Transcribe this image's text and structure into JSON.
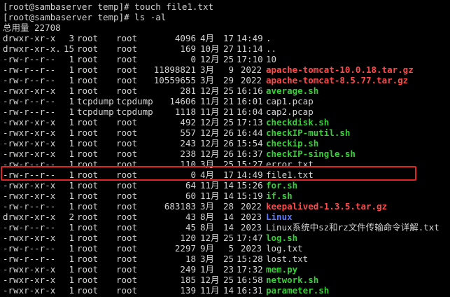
{
  "colors": {
    "default_text": "#d4d4d4",
    "directory": "#5c78ff",
    "executable": "#36d036",
    "archive": "#ff4a4a",
    "highlight_box": "#e02424"
  },
  "commands": [
    "[root@sambaserver temp]# touch file1.txt",
    "[root@sambaserver temp]# ls -al"
  ],
  "total_line": "总用量 22708",
  "listing": [
    {
      "perm": "drwxr-xr-x",
      "links": "3",
      "owner": "root",
      "group": "root",
      "size": "4096",
      "month": "4月",
      "day": "17",
      "time": "14:49",
      "name": ".",
      "kind": "default"
    },
    {
      "perm": "drwxr-xr-x.",
      "links": "15",
      "owner": "root",
      "group": "root",
      "size": "169",
      "month": "10月",
      "day": "27",
      "time": "11:14",
      "name": "..",
      "kind": "default"
    },
    {
      "perm": "-rw-r--r--",
      "links": "1",
      "owner": "root",
      "group": "root",
      "size": "0",
      "month": "12月",
      "day": "25",
      "time": "17:10",
      "name": "10",
      "kind": "default"
    },
    {
      "perm": "-rw-r--r--",
      "links": "1",
      "owner": "root",
      "group": "root",
      "size": "11898821",
      "month": "3月",
      "day": "9",
      "time": "2022",
      "name": "apache-tomcat-10.0.18.tar.gz",
      "kind": "archive"
    },
    {
      "perm": "-rw-r--r--",
      "links": "1",
      "owner": "root",
      "group": "root",
      "size": "10559655",
      "month": "3月",
      "day": "29",
      "time": "2022",
      "name": "apache-tomcat-8.5.77.tar.gz",
      "kind": "archive"
    },
    {
      "perm": "-rwxr-xr-x",
      "links": "1",
      "owner": "root",
      "group": "root",
      "size": "281",
      "month": "12月",
      "day": "25",
      "time": "16:16",
      "name": "average.sh",
      "kind": "executable"
    },
    {
      "perm": "-rw-r--r--",
      "links": "1",
      "owner": "tcpdump",
      "group": "tcpdump",
      "size": "14606",
      "month": "11月",
      "day": "21",
      "time": "16:01",
      "name": "cap1.pcap",
      "kind": "default"
    },
    {
      "perm": "-rw-r--r--",
      "links": "1",
      "owner": "tcpdump",
      "group": "tcpdump",
      "size": "1118",
      "month": "11月",
      "day": "21",
      "time": "16:04",
      "name": "cap2.pcap",
      "kind": "default"
    },
    {
      "perm": "-rwxr-xr-x",
      "links": "1",
      "owner": "root",
      "group": "root",
      "size": "492",
      "month": "12月",
      "day": "25",
      "time": "17:13",
      "name": "checkdisk.sh",
      "kind": "executable"
    },
    {
      "perm": "-rwxr-xr-x",
      "links": "1",
      "owner": "root",
      "group": "root",
      "size": "557",
      "month": "12月",
      "day": "26",
      "time": "16:44",
      "name": "checkIP-mutil.sh",
      "kind": "executable"
    },
    {
      "perm": "-rwxr-xr-x",
      "links": "1",
      "owner": "root",
      "group": "root",
      "size": "243",
      "month": "12月",
      "day": "26",
      "time": "15:54",
      "name": "checkip.sh",
      "kind": "executable"
    },
    {
      "perm": "-rwxr-xr-x",
      "links": "1",
      "owner": "root",
      "group": "root",
      "size": "238",
      "month": "12月",
      "day": "26",
      "time": "16:37",
      "name": "checkIP-single.sh",
      "kind": "executable"
    },
    {
      "perm": "-rw-r--r--",
      "links": "1",
      "owner": "root",
      "group": "root",
      "size": "110",
      "month": "3月",
      "day": "25",
      "time": "15:27",
      "name": "error.txt",
      "kind": "default"
    },
    {
      "perm": "-rw-r--r--",
      "links": "1",
      "owner": "root",
      "group": "root",
      "size": "0",
      "month": "4月",
      "day": "17",
      "time": "14:49",
      "name": "file1.txt",
      "kind": "default"
    },
    {
      "perm": "-rwxr-xr-x",
      "links": "1",
      "owner": "root",
      "group": "root",
      "size": "64",
      "month": "11月",
      "day": "14",
      "time": "15:26",
      "name": "for.sh",
      "kind": "executable"
    },
    {
      "perm": "-rwxr-xr-x",
      "links": "1",
      "owner": "root",
      "group": "root",
      "size": "60",
      "month": "11月",
      "day": "14",
      "time": "15:19",
      "name": "if.sh",
      "kind": "executable"
    },
    {
      "perm": "-rw-r--r--",
      "links": "1",
      "owner": "root",
      "group": "root",
      "size": "683183",
      "month": "3月",
      "day": "28",
      "time": "2022",
      "name": "keepalived-1.3.5.tar.gz",
      "kind": "archive"
    },
    {
      "perm": "drwxr-xr-x",
      "links": "2",
      "owner": "root",
      "group": "root",
      "size": "43",
      "month": "8月",
      "day": "14",
      "time": "2023",
      "name": "Linux",
      "kind": "directory"
    },
    {
      "perm": "-rw-r--r--",
      "links": "1",
      "owner": "root",
      "group": "root",
      "size": "45",
      "month": "8月",
      "day": "14",
      "time": "2023",
      "name": "Linux系统中sz和rz文件传输命令详解.txt",
      "kind": "default"
    },
    {
      "perm": "-rwxr-xr-x",
      "links": "1",
      "owner": "root",
      "group": "root",
      "size": "120",
      "month": "12月",
      "day": "25",
      "time": "17:47",
      "name": "log.sh",
      "kind": "executable"
    },
    {
      "perm": "-rw-r--r--",
      "links": "1",
      "owner": "root",
      "group": "root",
      "size": "2297",
      "month": "9月",
      "day": "5",
      "time": "2023",
      "name": "log.txt",
      "kind": "default"
    },
    {
      "perm": "-rw-r--r--",
      "links": "1",
      "owner": "root",
      "group": "root",
      "size": "18",
      "month": "3月",
      "day": "25",
      "time": "15:28",
      "name": "lost.txt",
      "kind": "default"
    },
    {
      "perm": "-rwxr-xr-x",
      "links": "1",
      "owner": "root",
      "group": "root",
      "size": "249",
      "month": "1月",
      "day": "23",
      "time": "17:32",
      "name": "mem.py",
      "kind": "executable"
    },
    {
      "perm": "-rwxr-xr-x",
      "links": "1",
      "owner": "root",
      "group": "root",
      "size": "185",
      "month": "12月",
      "day": "25",
      "time": "16:58",
      "name": "network.sh",
      "kind": "executable"
    },
    {
      "perm": "-rwxr-xr-x",
      "links": "1",
      "owner": "root",
      "group": "root",
      "size": "139",
      "month": "11月",
      "day": "14",
      "time": "16:31",
      "name": "parameter.sh",
      "kind": "executable"
    }
  ]
}
